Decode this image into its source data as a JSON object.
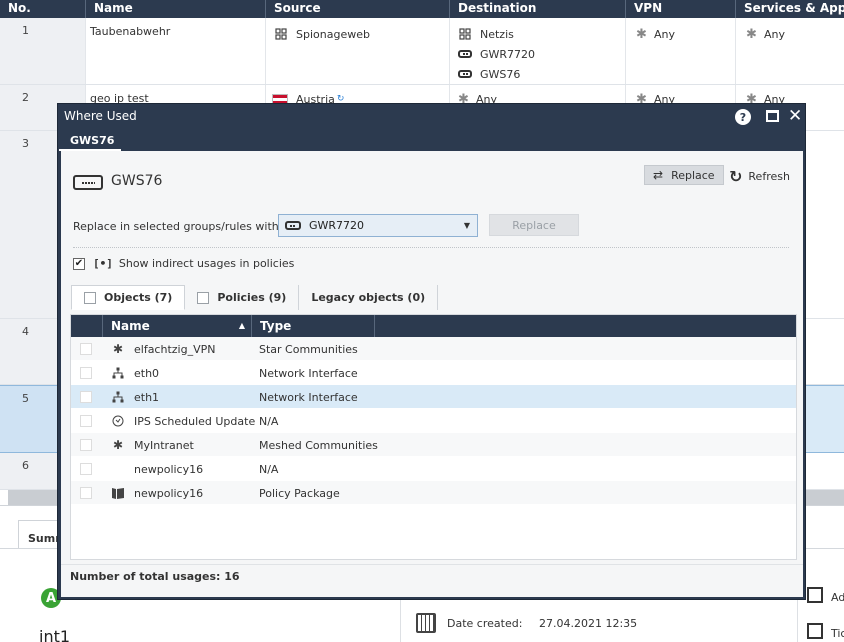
{
  "rulebase": {
    "columns": [
      "No.",
      "Name",
      "Source",
      "Destination",
      "VPN",
      "Services & Applica"
    ],
    "rows": [
      {
        "no": "1",
        "name": "Taubenabwehr",
        "source": [
          {
            "icon": "network-group-icon",
            "label": "Spionageweb"
          }
        ],
        "destination": [
          {
            "icon": "network-group-icon",
            "label": "Netzis"
          },
          {
            "icon": "gateway-icon",
            "label": "GWR7720"
          },
          {
            "icon": "gateway-icon",
            "label": "GWS76"
          }
        ],
        "vpn": "Any",
        "services": "Any"
      },
      {
        "no": "2",
        "name": "geo ip test",
        "source": [
          {
            "icon": "austria-flag-icon",
            "label": "Austria"
          }
        ],
        "destination": [
          {
            "icon": "any-icon",
            "label": "Any"
          }
        ],
        "vpn": "Any",
        "services": "Any"
      },
      {
        "no": "3"
      },
      {
        "no": "4"
      },
      {
        "no": "5"
      },
      {
        "no": "6"
      }
    ]
  },
  "summary": {
    "tab_label": "Summ",
    "rule_name": "int1",
    "date_created_label": "Date created:",
    "date_created_value": "27.04.2021 12:35",
    "right_items": [
      "Ad",
      "Tic"
    ]
  },
  "dialog": {
    "title": "Where Used",
    "tab": "GWS76",
    "object_name": "GWS76",
    "replace_button": "Replace",
    "refresh_button": "Refresh",
    "replace_label": "Replace in selected groups/rules with",
    "replace_value": "GWR7720",
    "replace_action": "Replace",
    "indirect_checked": true,
    "indirect_prefix": "[•]",
    "indirect_label": "Show indirect usages in policies",
    "subtabs": [
      "Objects (7)",
      "Policies (9)",
      "Legacy objects (0)"
    ],
    "grid": {
      "columns": [
        "Name",
        "Type"
      ],
      "rows": [
        {
          "icon": "star-community-icon",
          "name": "elfachtzig_VPN",
          "type": "Star Communities"
        },
        {
          "icon": "network-interface-icon",
          "name": "eth0",
          "type": "Network Interface"
        },
        {
          "icon": "network-interface-icon",
          "name": "eth1",
          "type": "Network Interface"
        },
        {
          "icon": "clock-icon",
          "name": "IPS Scheduled Update",
          "type": "N/A"
        },
        {
          "icon": "meshed-community-icon",
          "name": "MyIntranet",
          "type": "Meshed Communities"
        },
        {
          "icon": "",
          "name": "newpolicy16",
          "type": "N/A"
        },
        {
          "icon": "policy-package-icon",
          "name": "newpolicy16",
          "type": "Policy Package"
        }
      ]
    },
    "footer": "Number of total usages: 16"
  }
}
